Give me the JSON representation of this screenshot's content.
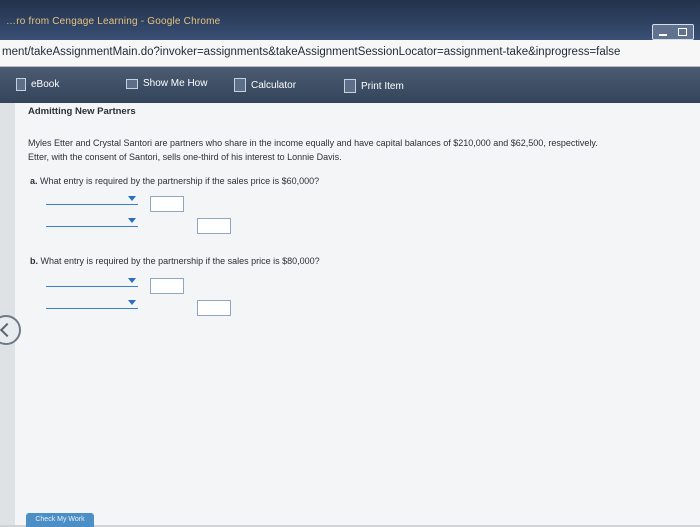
{
  "window": {
    "title": "…ro from Cengage Learning - Google Chrome"
  },
  "browser": {
    "url": "ment/takeAssignmentMain.do?invoker=assignments&takeAssignmentSessionLocator=assignment-take&inprogress=false"
  },
  "toolbar": {
    "items": [
      {
        "label": "eBook",
        "icon": "book-icon"
      },
      {
        "label": "Show Me How",
        "icon": "video-icon"
      },
      {
        "label": "Calculator",
        "icon": "calculator-icon"
      },
      {
        "label": "Print Item",
        "icon": "print-icon"
      }
    ]
  },
  "problem": {
    "heading": "Admitting New Partners",
    "line1": "Myles Etter and Crystal Santori are partners who share in the income equally and have capital balances of $210,000 and $62,500, respectively.",
    "line2": "Etter, with the consent of Santori, sells one-third of his interest to Lonnie Davis.",
    "q_a_letter": "a.",
    "q_a_text": "What entry is required by the partnership if the sales price is $60,000?",
    "q_b_letter": "b.",
    "q_b_text": "What entry is required by the partnership if the sales price is $80,000?"
  },
  "footer": {
    "check_label": "Check My Work"
  },
  "colors": {
    "toolbar": "#3a4b63",
    "accent": "#3a7fd0"
  }
}
